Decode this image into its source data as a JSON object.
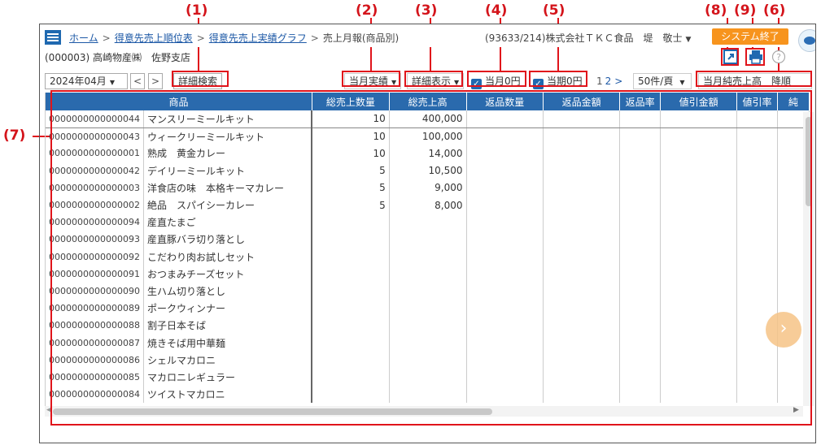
{
  "annotations": [
    "(1)",
    "(2)",
    "(3)",
    "(4)",
    "(5)",
    "(8)",
    "(9)",
    "(6)",
    "(7)"
  ],
  "header": {
    "breadcrumbs": [
      "ホーム",
      "得意先売上順位表",
      "得意先売上実績グラフ"
    ],
    "current": "売上月報(商品別)",
    "separator": ">",
    "company": "(93633/214)株式会社ＴＫＣ食品　堤　敬士",
    "exit_label": "システム終了"
  },
  "subheader": "(000003) 高崎物産㈱　佐野支店",
  "toolbar": {
    "month": "2024年04月",
    "prev": "<",
    "next": ">",
    "detail_search": "詳細検索",
    "period": "当月実績",
    "display": "詳細表示",
    "chk_month_zero": "当月0円",
    "chk_term_zero": "当期0円",
    "page1": "1",
    "page2": "2",
    "page_next": ">",
    "per_page": "50件/頁",
    "sort": "当月純売上高　降順"
  },
  "table": {
    "headers": [
      "商品",
      "",
      "総売上数量",
      "総売上高",
      "返品数量",
      "返品金額",
      "返品率",
      "値引金額",
      "値引率",
      "純"
    ],
    "rows": [
      {
        "code": "0000000000000044",
        "name": "マンスリーミールキット",
        "qty": "10",
        "sales": "400,000"
      },
      {
        "code": "0000000000000043",
        "name": "ウィークリーミールキット",
        "qty": "10",
        "sales": "100,000"
      },
      {
        "code": "0000000000000001",
        "name": "熟成　黄金カレー",
        "qty": "10",
        "sales": "14,000"
      },
      {
        "code": "0000000000000042",
        "name": "デイリーミールキット",
        "qty": "5",
        "sales": "10,500"
      },
      {
        "code": "0000000000000003",
        "name": "洋食店の味　本格キーマカレー",
        "qty": "5",
        "sales": "9,000"
      },
      {
        "code": "0000000000000002",
        "name": "絶品　スパイシーカレー",
        "qty": "5",
        "sales": "8,000"
      },
      {
        "code": "0000000000000094",
        "name": "産直たまご",
        "qty": "",
        "sales": ""
      },
      {
        "code": "0000000000000093",
        "name": "産直豚バラ切り落とし",
        "qty": "",
        "sales": ""
      },
      {
        "code": "0000000000000092",
        "name": "こだわり肉お試しセット",
        "qty": "",
        "sales": ""
      },
      {
        "code": "0000000000000091",
        "name": "おつまみチーズセット",
        "qty": "",
        "sales": ""
      },
      {
        "code": "0000000000000090",
        "name": "生ハム切り落とし",
        "qty": "",
        "sales": ""
      },
      {
        "code": "0000000000000089",
        "name": "ポークウィンナー",
        "qty": "",
        "sales": ""
      },
      {
        "code": "0000000000000088",
        "name": "割子日本そば",
        "qty": "",
        "sales": ""
      },
      {
        "code": "0000000000000087",
        "name": "焼きそば用中華麺",
        "qty": "",
        "sales": ""
      },
      {
        "code": "0000000000000086",
        "name": "シェルマカロニ",
        "qty": "",
        "sales": ""
      },
      {
        "code": "0000000000000085",
        "name": "マカロニレギュラー",
        "qty": "",
        "sales": ""
      },
      {
        "code": "0000000000000084",
        "name": "ツイストマカロニ",
        "qty": "",
        "sales": ""
      }
    ]
  },
  "colors": {
    "accent": "#2a6aad",
    "annotation": "#e0141b",
    "exit": "#f7941d"
  },
  "icons": [
    "menu-icon",
    "external-link-icon",
    "print-icon",
    "help-icon",
    "chevron-right-icon"
  ]
}
